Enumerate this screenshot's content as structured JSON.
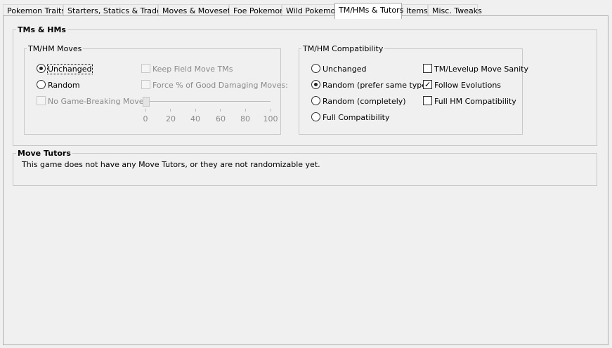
{
  "tabs": [
    {
      "label": "Pokemon Traits"
    },
    {
      "label": "Starters, Statics & Trades"
    },
    {
      "label": "Moves & Movesets"
    },
    {
      "label": "Foe Pokemon"
    },
    {
      "label": "Wild Pokemon"
    },
    {
      "label": "TM/HMs & Tutors"
    },
    {
      "label": "Items"
    },
    {
      "label": "Misc. Tweaks"
    }
  ],
  "active_tab": "TM/HMs & Tutors",
  "tms_hms": {
    "title": "TMs & HMs",
    "moves": {
      "title": "TM/HM Moves",
      "unchanged": "Unchanged",
      "random": "Random",
      "no_game_breaking": "No Game-Breaking Moves",
      "keep_field_move": "Keep Field Move TMs",
      "force_good_damaging": "Force % of Good Damaging Moves:",
      "slider_value": 0,
      "slider_labels": [
        "0",
        "20",
        "40",
        "60",
        "80",
        "100"
      ]
    },
    "compat": {
      "title": "TM/HM Compatibility",
      "unchanged": "Unchanged",
      "random_same_type": "Random (prefer same type)",
      "random_completely": "Random (completely)",
      "full_compat": "Full Compatibility",
      "levelup_sanity": "TM/Levelup Move Sanity",
      "follow_evolutions": "Follow Evolutions",
      "full_hm_compat": "Full HM Compatibility",
      "checkmark": "✓"
    }
  },
  "move_tutors": {
    "title": "Move Tutors",
    "message": "This game does not have any Move Tutors, or they are not randomizable yet."
  }
}
